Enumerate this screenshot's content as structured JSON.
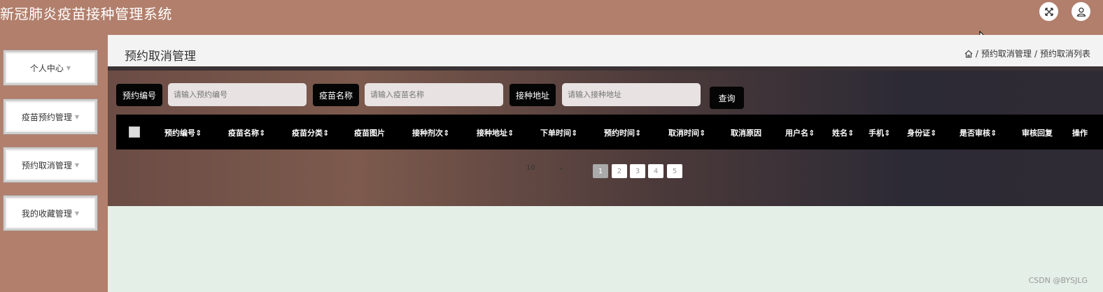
{
  "app": {
    "title": "新冠肺炎疫苗接种管理系统"
  },
  "icons": {
    "fullscreen": "fullscreen-icon",
    "user": "user-icon",
    "home": "home-icon"
  },
  "sidebar": {
    "items": [
      {
        "label": "个人中心"
      },
      {
        "label": "疫苗预约管理"
      },
      {
        "label": "预约取消管理"
      },
      {
        "label": "我的收藏管理"
      }
    ]
  },
  "page": {
    "title": "预约取消管理"
  },
  "breadcrumb": {
    "items": [
      "预约取消管理",
      "预约取消列表"
    ],
    "separator": "/"
  },
  "search": {
    "fields": [
      {
        "label": "预约编号",
        "placeholder": "请输入预约编号"
      },
      {
        "label": "疫苗名称",
        "placeholder": "请输入疫苗名称"
      },
      {
        "label": "接种地址",
        "placeholder": "请输入接种地址"
      }
    ],
    "query_label": "查询"
  },
  "table": {
    "columns": [
      "预约编号",
      "疫苗名称",
      "疫苗分类",
      "疫苗图片",
      "接种剂次",
      "接种地址",
      "下单时间",
      "预约时间",
      "取消时间",
      "取消原因",
      "用户名",
      "姓名",
      "手机",
      "身份证",
      "是否审核",
      "审核回复",
      "操作"
    ],
    "sortable": [
      true,
      true,
      true,
      false,
      true,
      true,
      true,
      true,
      true,
      false,
      true,
      true,
      true,
      true,
      true,
      false,
      false
    ],
    "sort_icon": "⇕"
  },
  "pagination": {
    "page_size": "10",
    "pages": [
      "1",
      "2",
      "3",
      "4",
      "5"
    ],
    "active_page": "1"
  },
  "watermark": "CSDN @BYSJLG",
  "colors": {
    "primary_bg": "#b27f6c",
    "main_bg": "#e4efe7",
    "accent_dark": "#050505"
  }
}
